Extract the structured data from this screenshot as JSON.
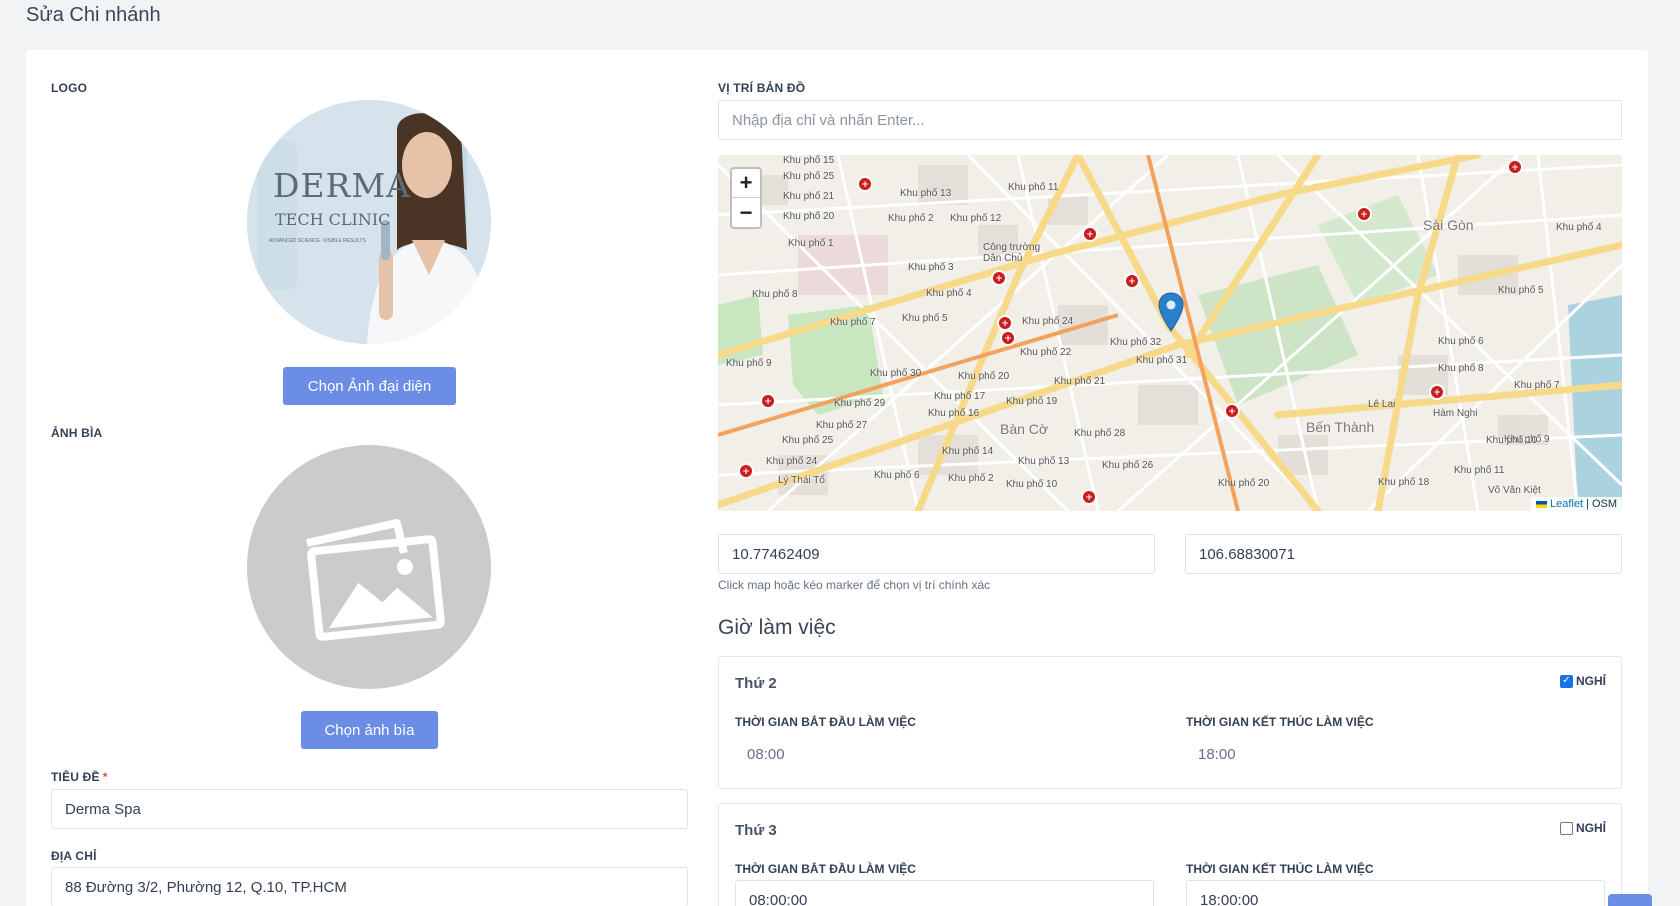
{
  "page": {
    "title": "Sửa Chi nhánh"
  },
  "logo": {
    "label": "LOGO",
    "image_brand": "DERMA",
    "image_sub": "TECH CLINIC",
    "image_tagline": "ADVANCED SCIENCE. VISIBLE RESULTS",
    "button": "Chọn Ảnh đại diện"
  },
  "cover": {
    "label": "ẢNH BÌA",
    "button": "Chọn ảnh bìa"
  },
  "title_field": {
    "label": "TIÊU ĐỀ",
    "required": "*",
    "value": "Derma Spa"
  },
  "address_field": {
    "label": "ĐỊA CHỈ",
    "value": "88 Đường 3/2, Phường 12, Q.10, TP.HCM"
  },
  "map": {
    "label": "VỊ TRÍ BẢN ĐỒ",
    "search_placeholder": "Nhập địa chỉ và nhấn Enter...",
    "zoom_in": "+",
    "zoom_out": "−",
    "attribution_leaflet": "Leaflet",
    "attribution_sep": "|",
    "attribution_osm": "OSM",
    "place_labels": [
      "Khu phố 15",
      "Khu phố 25",
      "Khu phố 21",
      "Khu phố 13",
      "Khu phố 11",
      "Khu phố 20",
      "Khu phố 2",
      "Khu phố 12",
      "Khu phố 1",
      "Khu phố 3",
      "Công trường Dân Chủ",
      "Khu phố 8",
      "Khu phố 4",
      "Khu phố 7",
      "Khu phố 5",
      "Khu phố 24",
      "Khu phố 32",
      "Khu phố 22",
      "Khu phố 9",
      "Khu phố 30",
      "Khu phố 31",
      "Khu phố 20",
      "Khu phố 21",
      "Khu phố 29",
      "Khu phố 17",
      "Khu phố 19",
      "Khu phố 16",
      "Khu phố 27",
      "Khu phố 28",
      "Bàn Cờ",
      "Khu phố 25",
      "Khu phố 14",
      "Khu phố 24",
      "Khu phố 13",
      "Khu phố 26",
      "Khu phố 6",
      "Khu phố 2",
      "Khu phố 10",
      "Lý Thái Tổ",
      "Sài Gòn",
      "Bến Thành",
      "Hàm Nghi",
      "Võ Văn Kiệt",
      "Lê Lai",
      "Khu phố 4",
      "Khu phố 5",
      "Khu phố 6",
      "Khu phố 8",
      "Khu phố 7",
      "Khu phố 9",
      "Khu phố 10",
      "Khu phố 11",
      "Khu phố 18",
      "Khu phố 20"
    ],
    "latitude": "10.77462409",
    "longitude": "106.68830071",
    "help": "Click map hoặc kéo marker để chọn vị trí chính xác"
  },
  "hours": {
    "title": "Giờ làm việc",
    "days": [
      {
        "name": "Thứ 2",
        "off_label": "NGHỈ",
        "off_checked": true,
        "start_label": "THỜI GIAN BẮT ĐẦU LÀM VIỆC",
        "end_label": "THỜI GIAN KẾT THÚC LÀM VIỆC",
        "start": "08:00",
        "end": "18:00"
      },
      {
        "name": "Thứ 3",
        "off_label": "NGHỈ",
        "off_checked": false,
        "start_label": "THỜI GIAN BẮT ĐẦU LÀM VIỆC",
        "end_label": "THỜI GIAN KẾT THÚC LÀM VIỆC",
        "start": "08:00:00",
        "end": "18:00:00"
      }
    ]
  },
  "colors": {
    "primary": "#6b8de6",
    "marker": "#2a81cb",
    "poi": "#c81e1e"
  }
}
